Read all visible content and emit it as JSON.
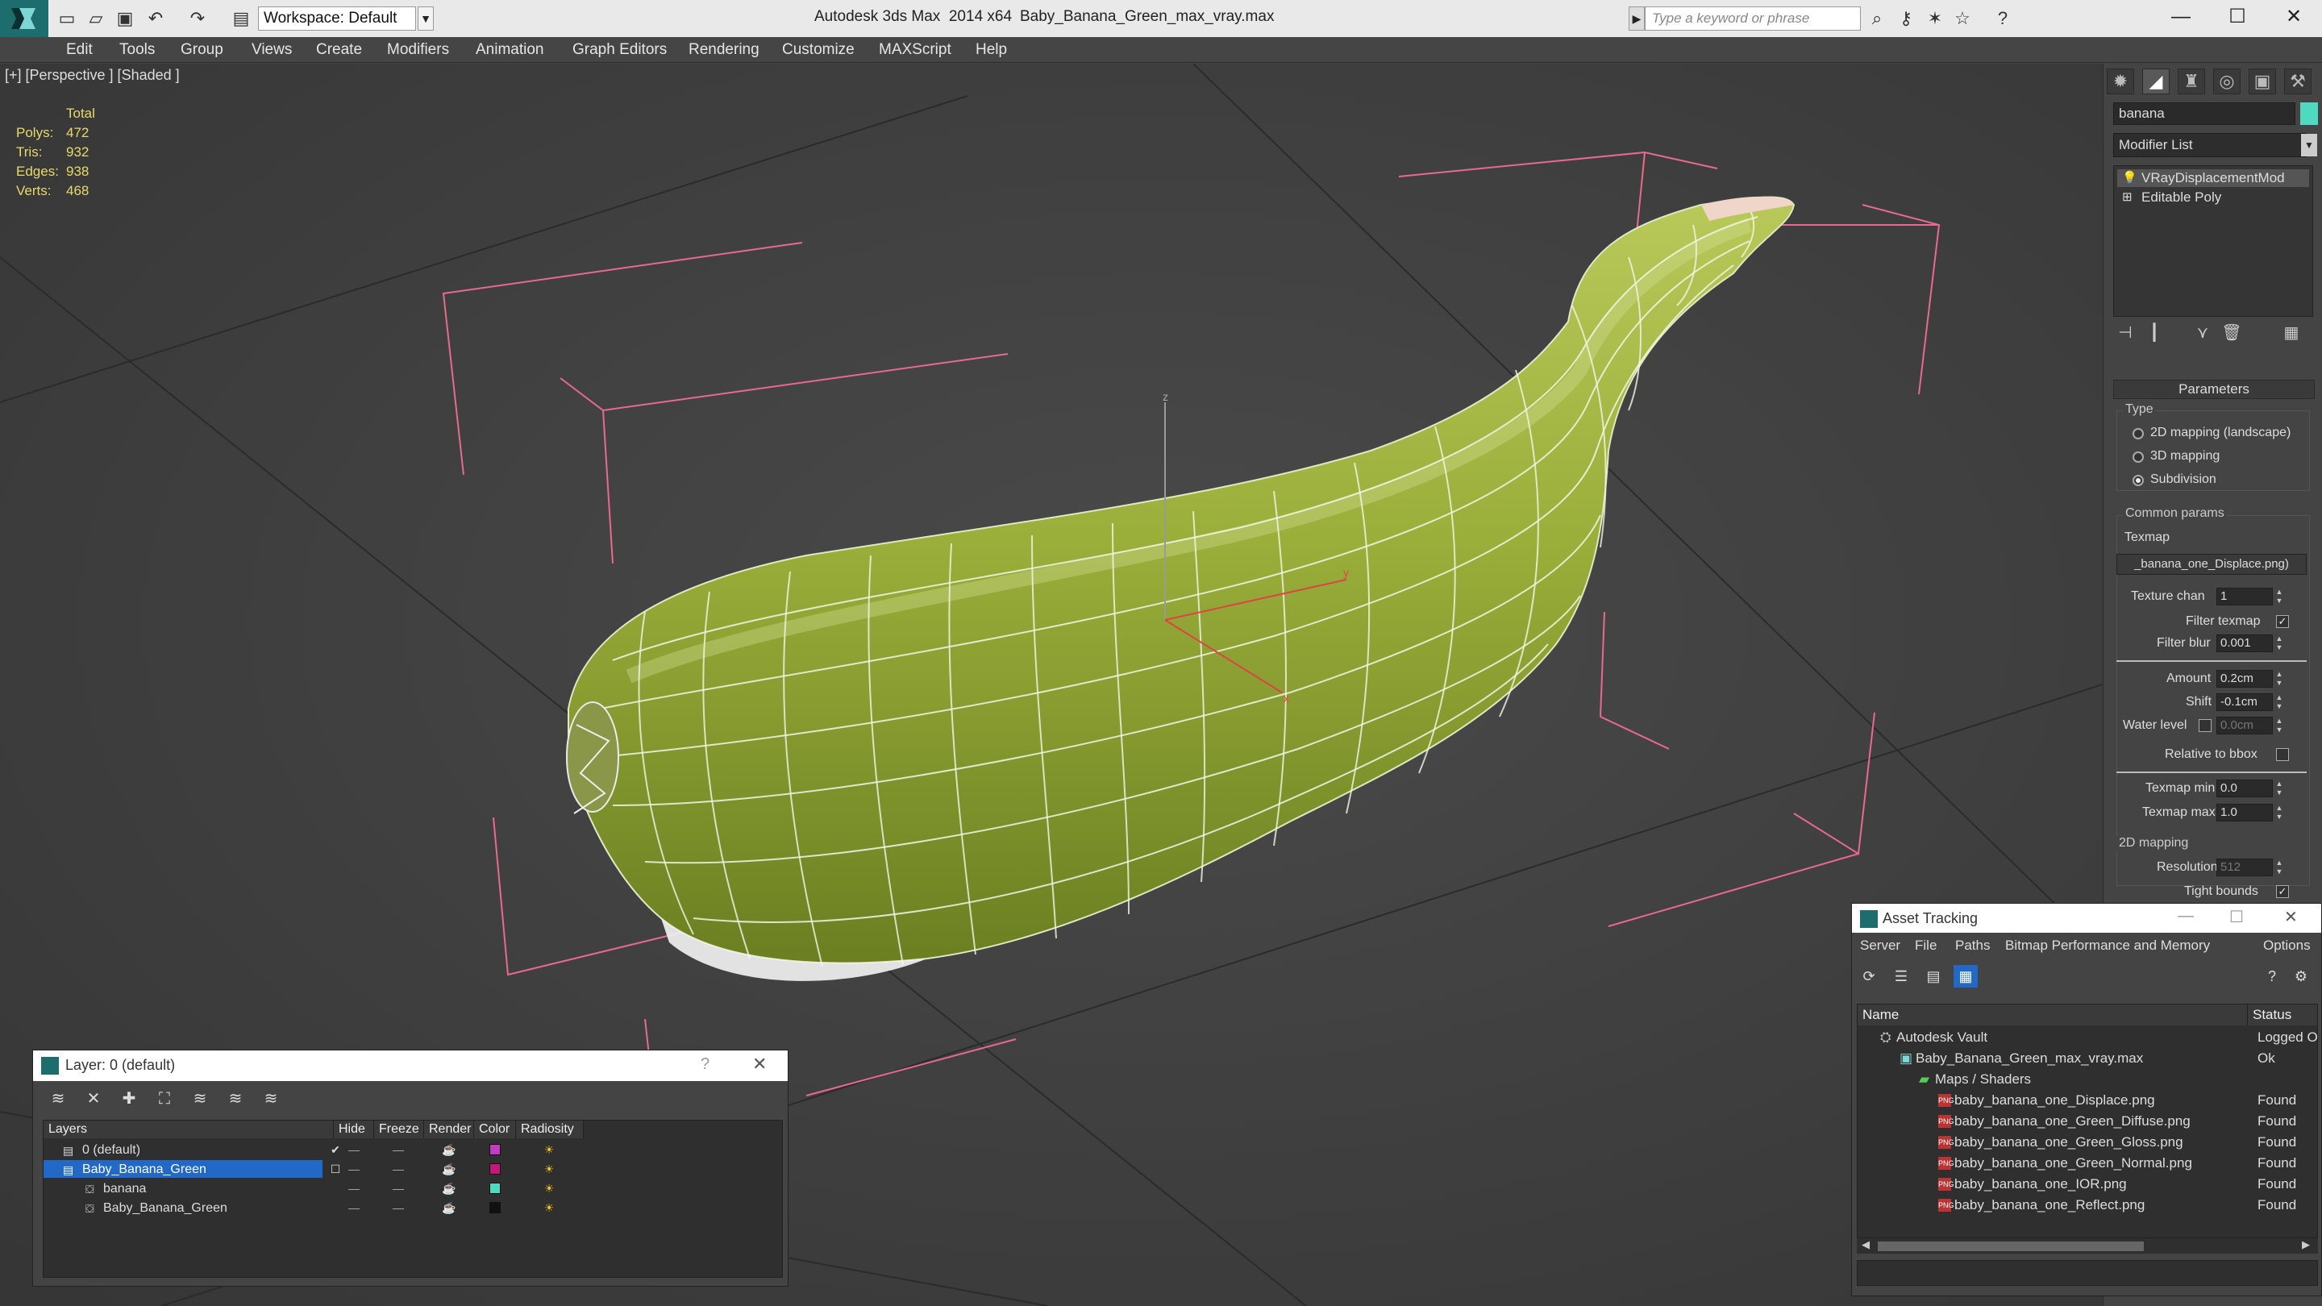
{
  "titlebar": {
    "workspace": "Workspace: Default",
    "app_title": "Autodesk 3ds Max  2014 x64",
    "file_title": "Baby_Banana_Green_max_vray.max",
    "search_placeholder": "Type a keyword or phrase",
    "minimize": "—",
    "maximize": "☐",
    "close": "✕"
  },
  "menu": [
    "Edit",
    "Tools",
    "Group",
    "Views",
    "Create",
    "Modifiers",
    "Animation",
    "Graph Editors",
    "Rendering",
    "Customize",
    "MAXScript",
    "Help"
  ],
  "viewport": {
    "label": "[+] [Perspective ] [Shaded ]",
    "stats_header": "Total",
    "stats": [
      {
        "k": "Polys:",
        "v": "472"
      },
      {
        "k": "Tris:",
        "v": "932"
      },
      {
        "k": "Edges:",
        "v": "938"
      },
      {
        "k": "Verts:",
        "v": "468"
      }
    ],
    "gizmo_z": "z",
    "gizmo_y": "y",
    "gizmo_x": "x"
  },
  "command_panel": {
    "object_name": "banana",
    "object_color": "#4fd9c0",
    "modifier_list": "Modifier List",
    "stack": [
      "VRayDisplacementMod",
      "Editable Poly"
    ],
    "rollout": "Parameters",
    "type_label": "Type",
    "type_options": [
      "2D mapping (landscape)",
      "3D mapping",
      "Subdivision"
    ],
    "common_label": "Common params",
    "texmap_label": "Texmap",
    "texmap_value": "_banana_one_Displace.png)",
    "texture_chan_label": "Texture chan",
    "texture_chan_value": "1",
    "filter_texmap_label": "Filter texmap",
    "filter_blur_label": "Filter blur",
    "filter_blur_value": "0.001",
    "amount_label": "Amount",
    "amount_value": "0.2cm",
    "shift_label": "Shift",
    "shift_value": "-0.1cm",
    "water_label": "Water level",
    "water_value": "0.0cm",
    "relative_label": "Relative to bbox",
    "texmap_min_label": "Texmap min",
    "texmap_min_value": "0.0",
    "texmap_max_label": "Texmap max",
    "texmap_max_value": "1.0",
    "mapping2d_label": "2D mapping",
    "resolution_label": "Resolution",
    "resolution_value": "512",
    "tight_label": "Tight bounds"
  },
  "layer_dialog": {
    "title": "Layer: 0 (default)",
    "help": "?",
    "close": "✕",
    "columns": [
      "Layers",
      "Hide",
      "Freeze",
      "Render",
      "Color",
      "Radiosity"
    ],
    "rows": [
      {
        "name": "0 (default)",
        "color": "#c23cc2"
      },
      {
        "name": "Baby_Banana_Green",
        "color": "#c2187a"
      },
      {
        "name": "banana",
        "color": "#4fd9c0"
      },
      {
        "name": "Baby_Banana_Green",
        "color": "#111111"
      }
    ]
  },
  "asset_dialog": {
    "title": "Asset Tracking",
    "menu": [
      "Server",
      "File",
      "Paths",
      "Bitmap Performance and Memory",
      "Options"
    ],
    "col_name": "Name",
    "col_status": "Status",
    "rows": [
      {
        "name": "Autodesk Vault",
        "status": "Logged O"
      },
      {
        "name": "Baby_Banana_Green_max_vray.max",
        "status": "Ok"
      },
      {
        "name": "Maps / Shaders",
        "status": ""
      },
      {
        "name": "baby_banana_one_Displace.png",
        "status": "Found"
      },
      {
        "name": "baby_banana_one_Green_Diffuse.png",
        "status": "Found"
      },
      {
        "name": "baby_banana_one_Green_Gloss.png",
        "status": "Found"
      },
      {
        "name": "baby_banana_one_Green_Normal.png",
        "status": "Found"
      },
      {
        "name": "baby_banana_one_IOR.png",
        "status": "Found"
      },
      {
        "name": "baby_banana_one_Reflect.png",
        "status": "Found"
      }
    ]
  }
}
